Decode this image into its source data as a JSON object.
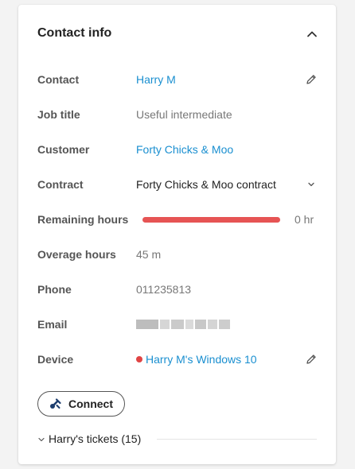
{
  "panel": {
    "title": "Contact info",
    "collapse_icon": "chevron-up-icon"
  },
  "fields": {
    "contact": {
      "label": "Contact",
      "value": "Harry M",
      "edit_icon": "pencil-icon"
    },
    "job_title": {
      "label": "Job title",
      "value": "Useful intermediate"
    },
    "customer": {
      "label": "Customer",
      "value": "Forty Chicks & Moo"
    },
    "contract": {
      "label": "Contract",
      "value": "Forty Chicks & Moo contract",
      "dropdown_icon": "chevron-down-icon"
    },
    "remaining_hours": {
      "label": "Remaining hours",
      "value": "0 hr",
      "bar_fill_fraction": 1.0
    },
    "overage_hours": {
      "label": "Overage hours",
      "value": "45 m"
    },
    "phone": {
      "label": "Phone",
      "value": "011235813"
    },
    "email": {
      "label": "Email",
      "value": ""
    },
    "device": {
      "label": "Device",
      "value": "Harry M's Windows 10",
      "status": "offline",
      "edit_icon": "pencil-icon"
    }
  },
  "connect_button": {
    "label": "Connect",
    "icon": "connect-icon"
  },
  "tickets_section": {
    "label": "Harry's tickets (15)",
    "icon": "chevron-down-icon"
  },
  "colors": {
    "link": "#1a8fd0",
    "bar_fill": "#e65454",
    "status_dot": "#e04444"
  }
}
